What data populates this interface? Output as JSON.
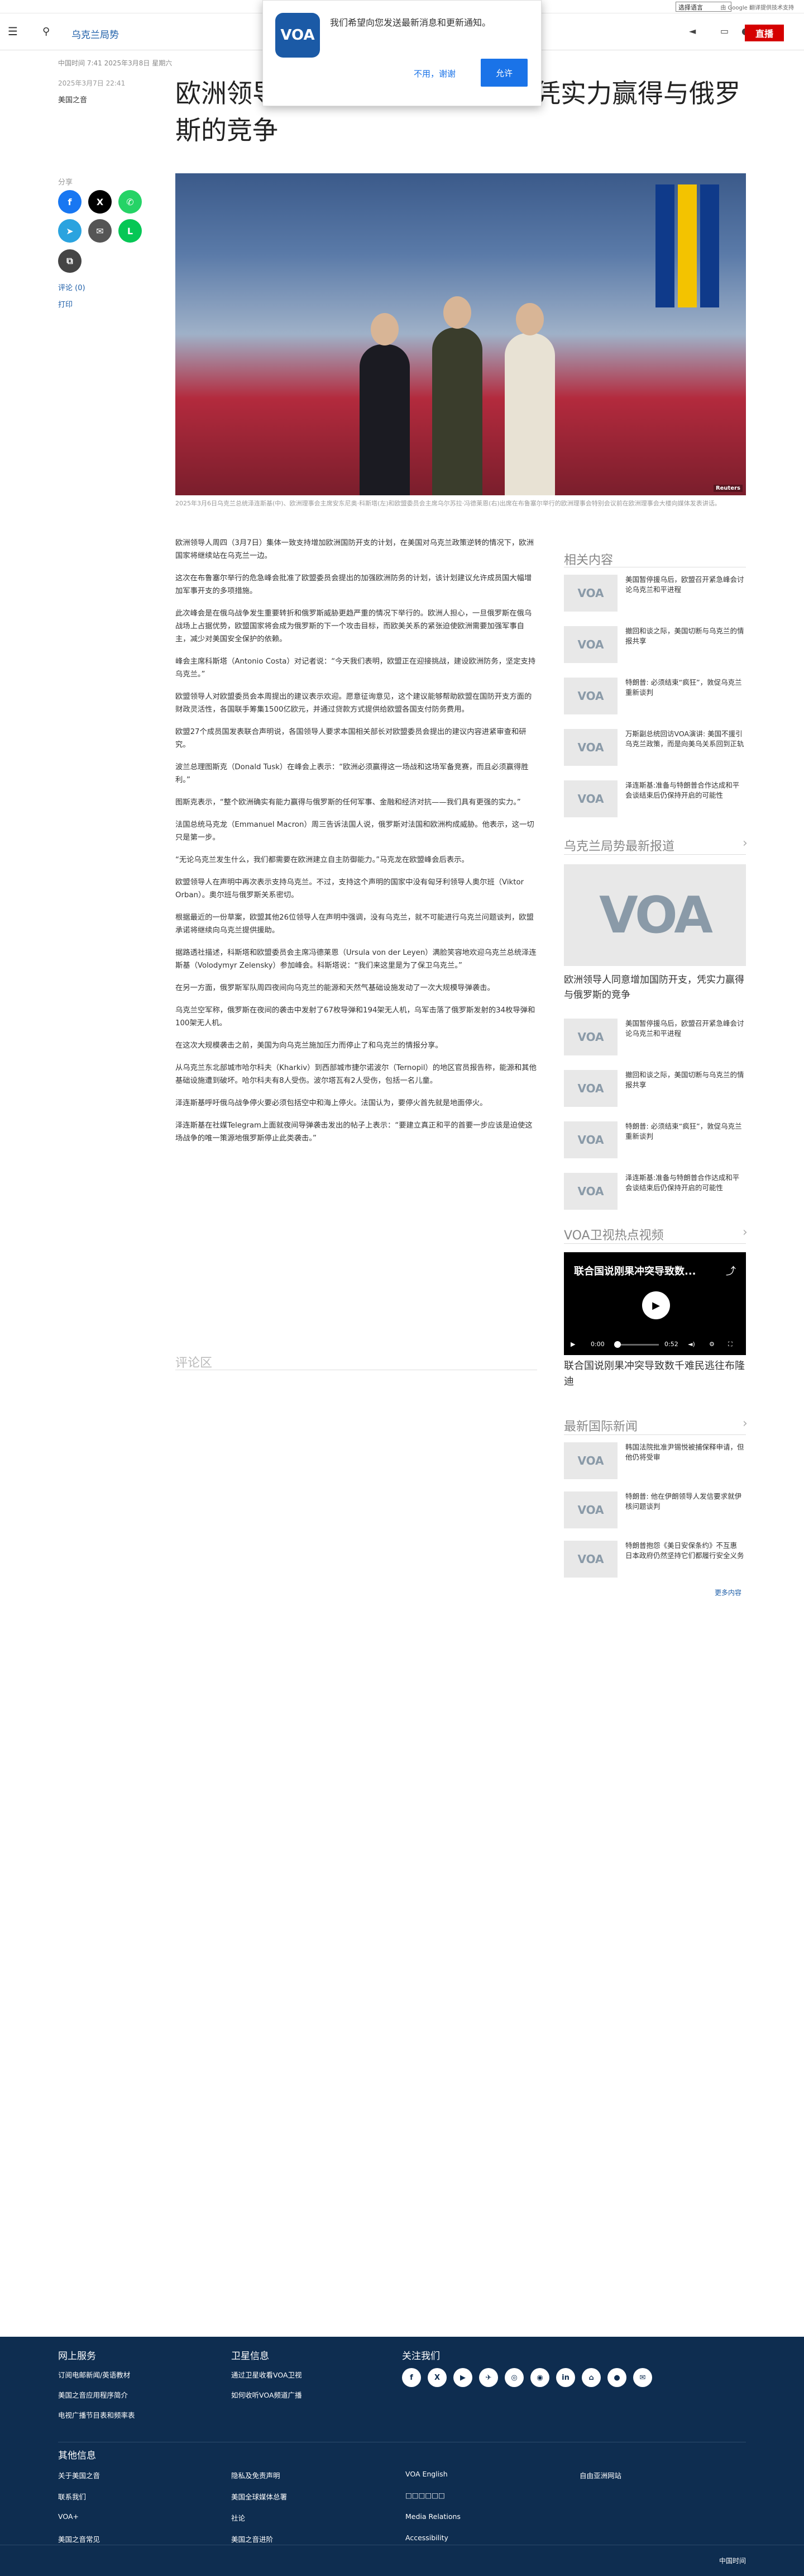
{
  "util": {
    "language_select": "选择语言",
    "powered": "由 Google 翻译提供技术支持"
  },
  "header": {
    "section": "乌克兰局势",
    "live": "直播",
    "logo": "VOA"
  },
  "notification": {
    "message": "我们希望向您发送最新消息和更新通知。",
    "decline": "不用，谢谢",
    "accept": "允许"
  },
  "dateline": "中国时间 7:41 2025年3月8日 星期六",
  "article": {
    "date": "2025年3月7日 22:41",
    "author": "美国之音",
    "headline": "欧洲领导人同意增加国防开支，凭实力赢得与俄罗斯的竞争",
    "share_label": "分享",
    "comments_link": "评论 (0)",
    "print_link": "打印",
    "photo_credit": "Reuters",
    "caption": "2025年3月6日乌克兰总统泽连斯基(中)、欧洲理事会主席安东尼奥·科斯塔(左)和欧盟委员会主席乌尔苏拉·冯德莱恩(右)出席在布鲁塞尔举行的欧洲理事会特别会议前在欧洲理事会大楼向媒体发表讲话。",
    "paragraphs": [
      "欧洲领导人周四（3月7日）集体一致支持增加欧洲国防开支的计划，在美国对乌克兰政策逆转的情况下，欧洲国家将继续站在乌克兰一边。",
      "这次在布鲁塞尔举行的危急峰会批准了欧盟委员会提出的加强欧洲防务的计划，该计划建议允许成员国大幅增加军事开支的多项措施。",
      "此次峰会是在俄乌战争发生重要转折和俄罗斯威胁更趋严重的情况下举行的。欧洲人担心，一旦俄罗斯在俄乌战场上占据优势，欧盟国家将会成为俄罗斯的下一个攻击目标，而欧美关系的紧张迫使欧洲需要加强军事自主，减少对美国安全保护的依赖。",
      "峰会主席科斯塔（Antonio Costa）对记者说：“今天我们表明，欧盟正在迎接挑战，建设欧洲防务，坚定支持乌克兰。”",
      "欧盟领导人对欧盟委员会本周提出的建议表示欢迎。愿意征询意见，这个建议能够帮助欧盟在国防开支方面的财政灵活性，各国联手筹集1500亿欧元，并通过贷款方式提供给欧盟各国支付防务费用。",
      "欧盟27个成员国发表联合声明说，各国领导人要求本国相关部长对欧盟委员会提出的建议内容进紧审查和研究。",
      "波兰总理图斯克（Donald Tusk）在峰会上表示：“欧洲必须赢得这一场战和这场军备竞赛，而且必须赢得胜利。”",
      "图斯克表示，“整个欧洲确实有能力赢得与俄罗斯的任何军事、金融和经济对抗——我们具有更强的实力。”",
      "法国总统马克龙（Emmanuel Macron）周三告诉法国人说，俄罗斯对法国和欧洲构成威胁。他表示，这一切只是第一步。",
      "“无论乌克兰发生什么，我们都需要在欧洲建立自主防御能力。”马克龙在欧盟峰会后表示。",
      "欧盟领导人在声明中再次表示支持乌克兰。不过，支持这个声明的国家中没有匈牙利领导人奥尔班（Viktor Orban）。奥尔班与俄罗斯关系密切。",
      "根据最近的一份草案，欧盟其他26位领导人在声明中强调，没有乌克兰，就不可能进行乌克兰问题谈判，欧盟承诺将继续向乌克兰提供援助。",
      "据路透社描述，科斯塔和欧盟委员会主席冯德莱恩（Ursula von der Leyen）满脸笑容地欢迎乌克兰总统泽连斯基（Volodymyr Zelensky）参加峰会。科斯塔说：“我们来这里是为了保卫乌克兰。”",
      "在另一方面，俄罗斯军队周四夜间向乌克兰的能源和天然气基础设施发动了一次大规模导弹袭击。",
      "乌克兰空军称，俄罗斯在夜间的袭击中发射了67枚导弹和194架无人机，乌军击落了俄罗斯发射的34枚导弹和100架无人机。",
      "在这次大规模袭击之前，美国为向乌克兰施加压力而停止了和乌克兰的情报分享。",
      "从乌克兰东北部城市哈尔科夫（Kharkiv）到西部城市捷尔诺波尔（Ternopil）的地区官员报告称，能源和其他基础设施遭到破坏。哈尔科夫有8人受伤。波尔塔瓦有2人受伤，包括一名儿童。",
      "泽连斯基呼吁俄乌战争停火要必须包括空中和海上停火。法国认为，要停火首先就是地面停火。",
      "泽连斯基在社媒Telegram上面就夜间导弹袭击发出的帖子上表示：“要建立真正和平的首要一步应该是迫使这场战争的唯一策源地俄罗斯停止此类袭击。”"
    ],
    "comments_heading": "评论区"
  },
  "sidebar": {
    "related_heading": "相关内容",
    "related": [
      "美国暂停援乌后，欧盟召开紧急峰会讨论乌克兰和平进程",
      "撤回和谈之际，美国切断与乌克兰的情报共享",
      "特朗普: 必须结束“疯狂”，敦促乌克兰重新谈判",
      "万斯副总统回访VOA演讲: 美国不援引乌克兰政策，而是向美乌关系回到正轨",
      "泽连斯基:准备与特朗普合作达成和平 会谈结束后仍保持开启的可能性"
    ],
    "ukraine_heading": "乌克兰局势最新报道",
    "featured_title": "欧洲领导人同意增加国防开支，凭实力赢得与俄罗斯的竞争",
    "ukraine": [
      "美国暂停援乌后，欧盟召开紧急峰会讨论乌克兰和平进程",
      "撤回和谈之际，美国切断与乌克兰的情报共享",
      "特朗普: 必须结束“疯狂”，敦促乌克兰重新谈判",
      "泽连斯基:准备与特朗普合作达成和平 会谈结束后仍保持开启的可能性"
    ],
    "video_heading": "VOA卫视热点视频",
    "video": {
      "overlay": "联合国说刚果冲突导致数...",
      "time_now": "0:00",
      "time_total": "0:52"
    },
    "video_title": "联合国说刚果冲突导致数千难民逃往布隆迪",
    "intl_heading": "最新国际新闻",
    "intl": [
      "韩国法院批准尹锡悦被捕保释申请，但他仍将受审",
      "特朗普: 他在伊朗领导人发信要求就伊核问题谈判",
      "特朗普抱怨《美日安保条约》不互惠 日本政府仍然坚持它们都履行安全义务"
    ],
    "more": "更多内容"
  },
  "footer": {
    "col1_heading": "网上服务",
    "col1": [
      "订阅电邮新闻/英语教材",
      "美国之音应用程序简介",
      "电视广播节目表和频率表"
    ],
    "col2_heading": "卫星信息",
    "col2": [
      "通过卫星收看VOA卫视",
      "如何收听VOA频道广播"
    ],
    "col3_heading": "关注我们",
    "social": [
      "f",
      "X",
      "▶",
      "✈",
      "◎",
      "◉",
      "in",
      "⌂",
      "●",
      "✉"
    ],
    "info_heading": "其他信息",
    "info": [
      [
        "关于美国之音",
        "隐私及免责声明",
        "VOA English",
        "自由亚洲网站"
      ],
      [
        "联系我们",
        "美国全球媒体总署",
        "□□□□□□",
        ""
      ],
      [
        "VOA+",
        "社论",
        "Media Relations",
        ""
      ],
      [
        "美国之音常见",
        "美国之音进阶",
        "Accessibility",
        ""
      ]
    ],
    "brand": "中国时间"
  }
}
